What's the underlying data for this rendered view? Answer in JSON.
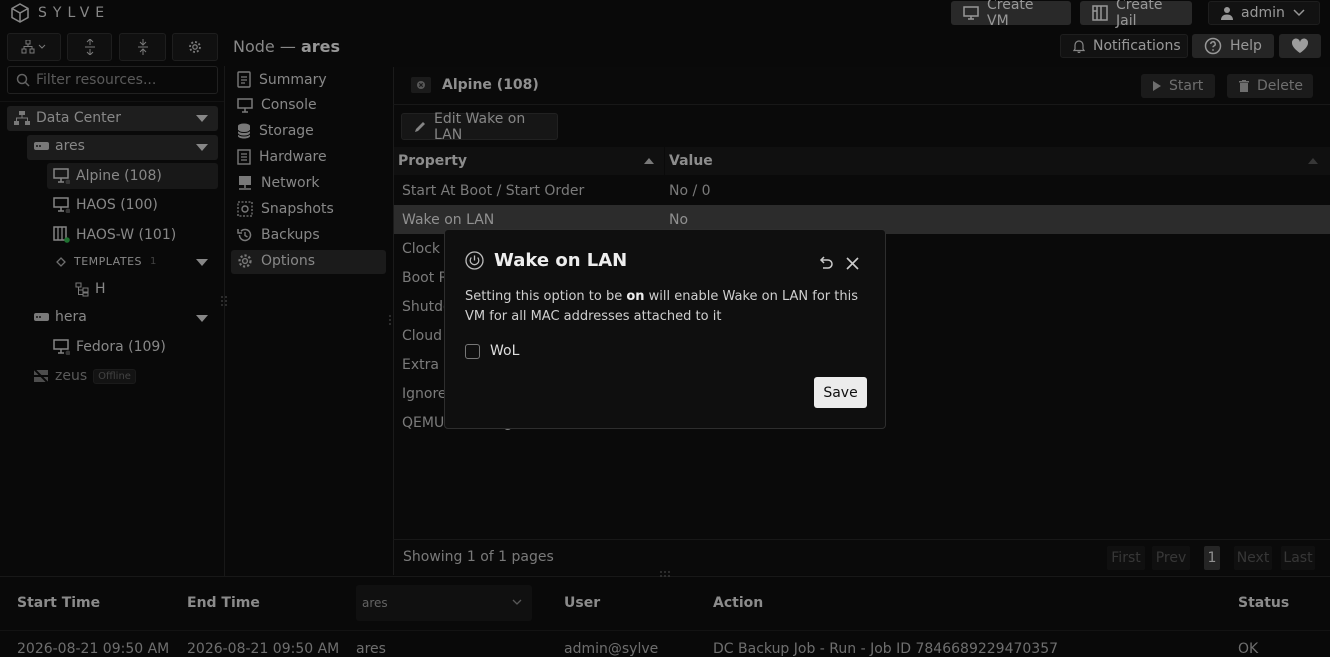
{
  "app": {
    "name": "SYLVE"
  },
  "topbar": {
    "create_vm": "Create VM",
    "create_jail": "Create Jail",
    "user": "admin",
    "notifications": "Notifications",
    "help": "Help"
  },
  "sidebar": {
    "search_placeholder": "Filter resources...",
    "datacenter": "Data Center",
    "nodes": [
      {
        "name": "ares",
        "vms": [
          "Alpine (108)",
          "HAOS (100)",
          "HAOS-W (101)"
        ],
        "templates_label": "TEMPLATES",
        "templates_count": "1",
        "template_item": "H"
      },
      {
        "name": "hera",
        "vms": [
          "Fedora (109)"
        ]
      },
      {
        "name": "zeus",
        "badge": "Offline"
      }
    ]
  },
  "header": {
    "prefix": "Node —",
    "node": "ares"
  },
  "menu": [
    "Summary",
    "Console",
    "Storage",
    "Hardware",
    "Network",
    "Snapshots",
    "Backups",
    "Options"
  ],
  "panel": {
    "title": "Alpine (108)",
    "start": "Start",
    "delete": "Delete",
    "edit_wol": "Edit Wake on LAN",
    "col_property": "Property",
    "col_value": "Value",
    "rows": [
      {
        "p": "Start At Boot / Start Order",
        "v": "No / 0"
      },
      {
        "p": "Wake on LAN",
        "v": "No"
      },
      {
        "p": "Clock Offset",
        "v": ""
      },
      {
        "p": "Boot ROM",
        "v": ""
      },
      {
        "p": "Shutdown Wait Time",
        "v": ""
      },
      {
        "p": "Cloud Init",
        "v": ""
      },
      {
        "p": "Extra Bhyve Options",
        "v": ""
      },
      {
        "p": "Ignore Unimplemented MSR",
        "v": ""
      },
      {
        "p": "QEMU Guest Agent",
        "v": ""
      }
    ],
    "showing": "Showing 1 of 1 pages",
    "pager": {
      "first": "First",
      "prev": "Prev",
      "page": "1",
      "next": "Next",
      "last": "Last"
    }
  },
  "modal": {
    "title": "Wake on LAN",
    "desc_before": "Setting this option to be ",
    "desc_bold": "on",
    "desc_after": " will enable Wake on LAN for this VM for all MAC addresses attached to it",
    "checkbox_label": "WoL",
    "save": "Save"
  },
  "audit": {
    "headers": {
      "start": "Start Time",
      "end": "End Time",
      "node_filter": "ares",
      "user": "User",
      "action": "Action",
      "status": "Status"
    },
    "row": {
      "start": "2026-08-21 09:50 AM",
      "end": "2026-08-21 09:50 AM",
      "node": "ares",
      "user": "admin@sylve",
      "action": "DC Backup Job - Run - Job ID 7846689229470357",
      "status": "OK"
    }
  }
}
